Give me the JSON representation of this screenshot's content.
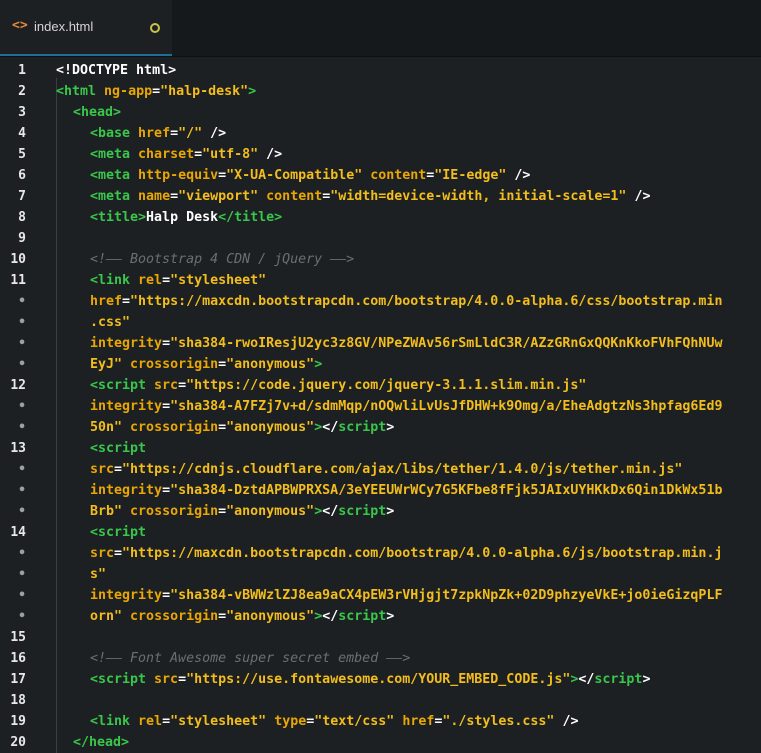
{
  "tab": {
    "icon": "code-brackets-icon",
    "title": "index.html",
    "modified": true
  },
  "colors": {
    "tag": "#39c64b",
    "attr": "#e9a700",
    "string": "#f3bd1b",
    "comment": "#6a6f73",
    "text": "#ffffff",
    "tab_accent": "#1f6e9a"
  },
  "lines": [
    {
      "n": "1",
      "indent": 0,
      "t": [
        [
          "tx",
          "<!DOCTYPE html>"
        ]
      ]
    },
    {
      "n": "2",
      "indent": 0,
      "t": [
        [
          "tg",
          "<html "
        ],
        [
          "at",
          "ng-app"
        ],
        [
          "tx",
          "="
        ],
        [
          "st",
          "\"halp-desk\""
        ],
        [
          "tg",
          ">"
        ]
      ]
    },
    {
      "n": "3",
      "indent": 1,
      "t": [
        [
          "tg",
          "<head>"
        ]
      ]
    },
    {
      "n": "4",
      "indent": 2,
      "t": [
        [
          "tg",
          "<base "
        ],
        [
          "at",
          "href"
        ],
        [
          "tx",
          "="
        ],
        [
          "st",
          "\"/\""
        ],
        [
          "tx",
          " />"
        ]
      ]
    },
    {
      "n": "5",
      "indent": 2,
      "t": [
        [
          "tg",
          "<meta "
        ],
        [
          "at",
          "charset"
        ],
        [
          "tx",
          "="
        ],
        [
          "st",
          "\"utf-8\""
        ],
        [
          "tx",
          " />"
        ]
      ]
    },
    {
      "n": "6",
      "indent": 2,
      "t": [
        [
          "tg",
          "<meta "
        ],
        [
          "at",
          "http-equiv"
        ],
        [
          "tx",
          "="
        ],
        [
          "st",
          "\"X-UA-Compatible\""
        ],
        [
          "tx",
          " "
        ],
        [
          "at",
          "content"
        ],
        [
          "tx",
          "="
        ],
        [
          "st",
          "\"IE-edge\""
        ],
        [
          "tx",
          " />"
        ]
      ]
    },
    {
      "n": "7",
      "indent": 2,
      "t": [
        [
          "tg",
          "<meta "
        ],
        [
          "at",
          "name"
        ],
        [
          "tx",
          "="
        ],
        [
          "st",
          "\"viewport\""
        ],
        [
          "tx",
          " "
        ],
        [
          "at",
          "content"
        ],
        [
          "tx",
          "="
        ],
        [
          "st",
          "\"width=device-width, initial-scale=1\""
        ],
        [
          "tx",
          " />"
        ]
      ]
    },
    {
      "n": "8",
      "indent": 2,
      "t": [
        [
          "tg",
          "<title>"
        ],
        [
          "tx",
          "Halp Desk"
        ],
        [
          "tg",
          "</title>"
        ]
      ]
    },
    {
      "n": "9",
      "indent": 0,
      "t": []
    },
    {
      "n": "10",
      "indent": 2,
      "t": [
        [
          "cm",
          "<!—— Bootstrap 4 CDN / jQuery ——>"
        ]
      ]
    },
    {
      "n": "11",
      "indent": 2,
      "t": [
        [
          "tg",
          "<link "
        ],
        [
          "at",
          "rel"
        ],
        [
          "tx",
          "="
        ],
        [
          "st",
          "\"stylesheet\""
        ]
      ]
    },
    {
      "n": "•",
      "indent": 2,
      "t": [
        [
          "at",
          "href"
        ],
        [
          "tx",
          "="
        ],
        [
          "st",
          "\"https://maxcdn.bootstrapcdn.com/bootstrap/4.0.0-alpha.6/css/bootstrap.min"
        ]
      ]
    },
    {
      "n": "•",
      "indent": 2,
      "t": [
        [
          "st",
          ".css\""
        ]
      ]
    },
    {
      "n": "•",
      "indent": 2,
      "t": [
        [
          "at",
          "integrity"
        ],
        [
          "tx",
          "="
        ],
        [
          "st",
          "\"sha384-rwoIResjU2yc3z8GV/NPeZWAv56rSmLldC3R/AZzGRnGxQQKnKkoFVhFQhNUw"
        ]
      ]
    },
    {
      "n": "•",
      "indent": 2,
      "t": [
        [
          "st",
          "EyJ\""
        ],
        [
          "tx",
          " "
        ],
        [
          "at",
          "crossorigin"
        ],
        [
          "tx",
          "="
        ],
        [
          "st",
          "\"anonymous\""
        ],
        [
          "tg",
          ">"
        ]
      ]
    },
    {
      "n": "12",
      "indent": 2,
      "t": [
        [
          "tg",
          "<script "
        ],
        [
          "at",
          "src"
        ],
        [
          "tx",
          "="
        ],
        [
          "st",
          "\"https://code.jquery.com/jquery-3.1.1.slim.min.js\""
        ]
      ]
    },
    {
      "n": "•",
      "indent": 2,
      "t": [
        [
          "at",
          "integrity"
        ],
        [
          "tx",
          "="
        ],
        [
          "st",
          "\"sha384-A7FZj7v+d/sdmMqp/nOQwliLvUsJfDHW+k9Omg/a/EheAdgtzNs3hpfag6Ed9"
        ]
      ]
    },
    {
      "n": "•",
      "indent": 2,
      "t": [
        [
          "st",
          "50n\""
        ],
        [
          "tx",
          " "
        ],
        [
          "at",
          "crossorigin"
        ],
        [
          "tx",
          "="
        ],
        [
          "st",
          "\"anonymous\""
        ],
        [
          "tg",
          ">"
        ],
        [
          "tx",
          "</"
        ],
        [
          "tg",
          "script"
        ],
        [
          "tx",
          ">"
        ]
      ]
    },
    {
      "n": "13",
      "indent": 2,
      "t": [
        [
          "tg",
          "<script"
        ]
      ]
    },
    {
      "n": "•",
      "indent": 2,
      "t": [
        [
          "at",
          "src"
        ],
        [
          "tx",
          "="
        ],
        [
          "st",
          "\"https://cdnjs.cloudflare.com/ajax/libs/tether/1.4.0/js/tether.min.js\""
        ]
      ]
    },
    {
      "n": "•",
      "indent": 2,
      "t": [
        [
          "at",
          "integrity"
        ],
        [
          "tx",
          "="
        ],
        [
          "st",
          "\"sha384-DztdAPBWPRXSA/3eYEEUWrWCy7G5KFbe8fFjk5JAIxUYHKkDx6Qin1DkWx51b"
        ]
      ]
    },
    {
      "n": "•",
      "indent": 2,
      "t": [
        [
          "st",
          "Brb\""
        ],
        [
          "tx",
          " "
        ],
        [
          "at",
          "crossorigin"
        ],
        [
          "tx",
          "="
        ],
        [
          "st",
          "\"anonymous\""
        ],
        [
          "tg",
          ">"
        ],
        [
          "tx",
          "</"
        ],
        [
          "tg",
          "script"
        ],
        [
          "tx",
          ">"
        ]
      ]
    },
    {
      "n": "14",
      "indent": 2,
      "t": [
        [
          "tg",
          "<script"
        ]
      ]
    },
    {
      "n": "•",
      "indent": 2,
      "t": [
        [
          "at",
          "src"
        ],
        [
          "tx",
          "="
        ],
        [
          "st",
          "\"https://maxcdn.bootstrapcdn.com/bootstrap/4.0.0-alpha.6/js/bootstrap.min.j"
        ]
      ]
    },
    {
      "n": "•",
      "indent": 2,
      "t": [
        [
          "st",
          "s\""
        ]
      ]
    },
    {
      "n": "•",
      "indent": 2,
      "t": [
        [
          "at",
          "integrity"
        ],
        [
          "tx",
          "="
        ],
        [
          "st",
          "\"sha384-vBWWzlZJ8ea9aCX4pEW3rVHjgjt7zpkNpZk+02D9phzyeVkE+jo0ieGizqPLF"
        ]
      ]
    },
    {
      "n": "•",
      "indent": 2,
      "t": [
        [
          "st",
          "orn\""
        ],
        [
          "tx",
          " "
        ],
        [
          "at",
          "crossorigin"
        ],
        [
          "tx",
          "="
        ],
        [
          "st",
          "\"anonymous\""
        ],
        [
          "tg",
          ">"
        ],
        [
          "tx",
          "</"
        ],
        [
          "tg",
          "script"
        ],
        [
          "tx",
          ">"
        ]
      ]
    },
    {
      "n": "15",
      "indent": 0,
      "t": []
    },
    {
      "n": "16",
      "indent": 2,
      "t": [
        [
          "cm",
          "<!—— Font Awesome super secret embed ——>"
        ]
      ]
    },
    {
      "n": "17",
      "indent": 2,
      "t": [
        [
          "tg",
          "<script "
        ],
        [
          "at",
          "src"
        ],
        [
          "tx",
          "="
        ],
        [
          "st",
          "\"https://use.fontawesome.com/YOUR_EMBED_CODE.js\""
        ],
        [
          "tg",
          ">"
        ],
        [
          "tx",
          "</"
        ],
        [
          "tg",
          "script"
        ],
        [
          "tx",
          ">"
        ]
      ]
    },
    {
      "n": "18",
      "indent": 0,
      "t": []
    },
    {
      "n": "19",
      "indent": 2,
      "t": [
        [
          "tg",
          "<link "
        ],
        [
          "at",
          "rel"
        ],
        [
          "tx",
          "="
        ],
        [
          "st",
          "\"stylesheet\""
        ],
        [
          "tx",
          " "
        ],
        [
          "at",
          "type"
        ],
        [
          "tx",
          "="
        ],
        [
          "st",
          "\"text/css\""
        ],
        [
          "tx",
          " "
        ],
        [
          "at",
          "href"
        ],
        [
          "tx",
          "="
        ],
        [
          "st",
          "\"./styles.css\""
        ],
        [
          "tx",
          " />"
        ]
      ]
    },
    {
      "n": "20",
      "indent": 1,
      "t": [
        [
          "tg",
          "</head>"
        ]
      ]
    }
  ]
}
